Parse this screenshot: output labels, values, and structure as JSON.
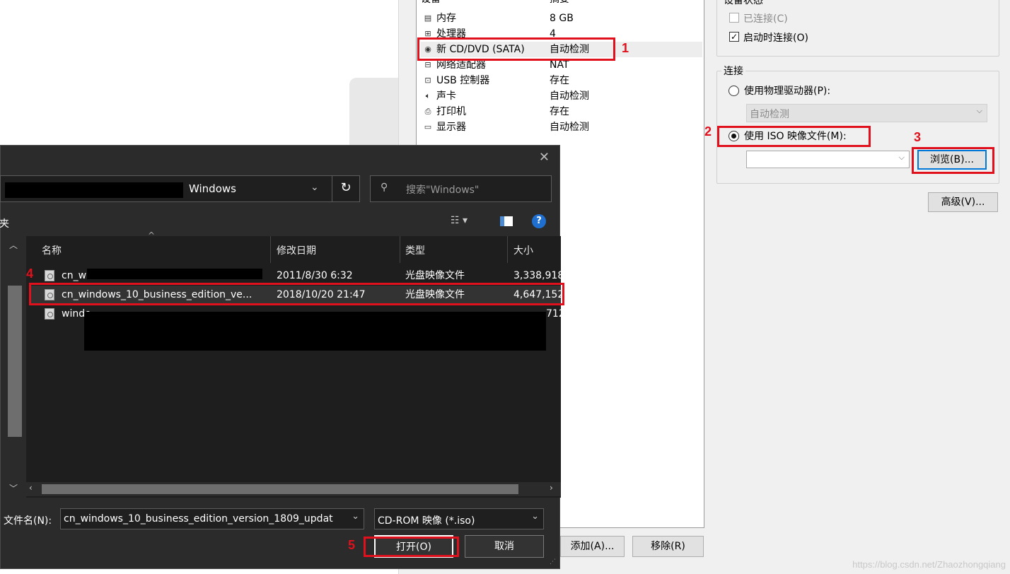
{
  "vm_settings": {
    "device_header": "设备",
    "summary_header": "摘要",
    "devices": [
      {
        "icon": "memory-icon",
        "name": "内存",
        "summary": "8 GB"
      },
      {
        "icon": "processor-icon",
        "name": "处理器",
        "summary": "4"
      },
      {
        "icon": "cd-dvd-icon",
        "name": "新 CD/DVD (SATA)",
        "summary": "自动检测"
      },
      {
        "icon": "network-adapter-icon",
        "name": "网络适配器",
        "summary": "NAT"
      },
      {
        "icon": "usb-icon",
        "name": "USB 控制器",
        "summary": "存在"
      },
      {
        "icon": "sound-icon",
        "name": "声卡",
        "summary": "自动检测"
      },
      {
        "icon": "printer-icon",
        "name": "打印机",
        "summary": "存在"
      },
      {
        "icon": "display-icon",
        "name": "显示器",
        "summary": "自动检测"
      }
    ],
    "device_status": {
      "title": "设备状态",
      "connected": "已连接(C)",
      "connect_at_power_on": "启动时连接(O)"
    },
    "connection": {
      "title": "连接",
      "physical_drive": "使用物理驱动器(P):",
      "physical_value": "自动检测",
      "iso_image": "使用 ISO 映像文件(M):",
      "iso_value": "",
      "browse": "浏览(B)...",
      "advanced": "高级(V)..."
    },
    "add_button": "添加(A)...",
    "remove_button": "移除(R)"
  },
  "file_dialog": {
    "path": "Windows",
    "search_placeholder": "搜索\"Windows\"",
    "left_label": "夹",
    "columns": [
      "名称",
      "修改日期",
      "类型",
      "大小"
    ],
    "files": [
      {
        "name": "cn_w",
        "date": "2011/8/30 6:32",
        "type": "光盘映像文件",
        "size": "3,338,918"
      },
      {
        "name": "cn_windows_10_business_edition_ve...",
        "date": "2018/10/20 21:47",
        "type": "光盘映像文件",
        "size": "4,647,152"
      },
      {
        "name": "windo",
        "date": "",
        "type": "",
        "size": "712"
      }
    ],
    "filename_label": "文件名(N):",
    "filename_value": "cn_windows_10_business_edition_version_1809_updat",
    "filter_value": "CD-ROM 映像 (*.iso)",
    "open_button": "打开(O)",
    "cancel_button": "取消"
  },
  "annotations": [
    "1",
    "2",
    "3",
    "4",
    "5"
  ],
  "watermark": "https://blog.csdn.net/Zhaozhongqiang",
  "colors": {
    "annotation_red": "#e0101c",
    "dialog_dark": "#2b2b2b",
    "accent": "#0078d7"
  }
}
